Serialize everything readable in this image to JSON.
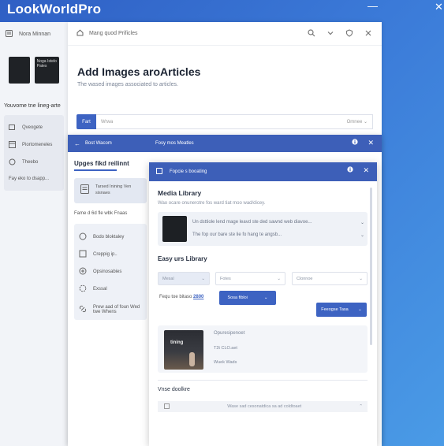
{
  "app": {
    "title": "LookWorldPro"
  },
  "left_panel": {
    "top_label": "Nora Minnan",
    "thumb1_text": "",
    "thumb2_text": "Noga Istelo Pates",
    "heading": "Youvome tne lineg-arte",
    "items": [
      {
        "label": "Qveogete"
      },
      {
        "label": "Piortomeneles"
      },
      {
        "label": "Theebo"
      },
      {
        "label": "Fay eko to dsapp..."
      }
    ]
  },
  "main": {
    "top_label": "Mang quod Prificles",
    "title": "Add Images aroArticles",
    "subtitle": "The wased images associated to articles.",
    "tab_label": "Fart",
    "search_placeholder": "Wrwa",
    "search_right": "Omnee"
  },
  "dialog1": {
    "back_label": "Bost Wacom",
    "title": "Fosy mos Meatles",
    "heading": "Upges fikd reilinnt",
    "card_text": "Tarsed Inining Ven sisnaes",
    "label": "Fame d 6d fle wbk Fnaas",
    "items": [
      {
        "label": "Bodo bloktaley"
      },
      {
        "label": "Creppig ip.."
      },
      {
        "label": "Opsinosabies"
      },
      {
        "label": "Exssal"
      },
      {
        "label": "Prew aad of foun Wed twe Whens"
      }
    ]
  },
  "dialog2": {
    "header_label": "Fopcie s booating",
    "title": "Media Library",
    "subtitle": "Wao ocare onunerotre fos ward tiat moo wad/dicey.",
    "row1": "Un dsttiole lend mage leavd ste ded sawnd web diavoe...",
    "row2": "The fop our bare ste lie fo hang te angsb...",
    "library_title": "Easy urs Library",
    "select1": "Mesal",
    "select2": "Fotes",
    "select3": "Clonnoe",
    "filter_label": "Fequ toe bitaso",
    "filter_link": "2800",
    "filter_button": "Sosa fibloi",
    "primary_button": "Feeogse Tasa",
    "result": {
      "caption": "tining",
      "line1": "Opuresipenoet",
      "line2": "T2t CLO.aet",
      "line3": "Wuek Wads"
    },
    "section_title": "Vnse doolkre",
    "option_text": "Wase sad cesonatdica sa ad coldtoaet"
  }
}
